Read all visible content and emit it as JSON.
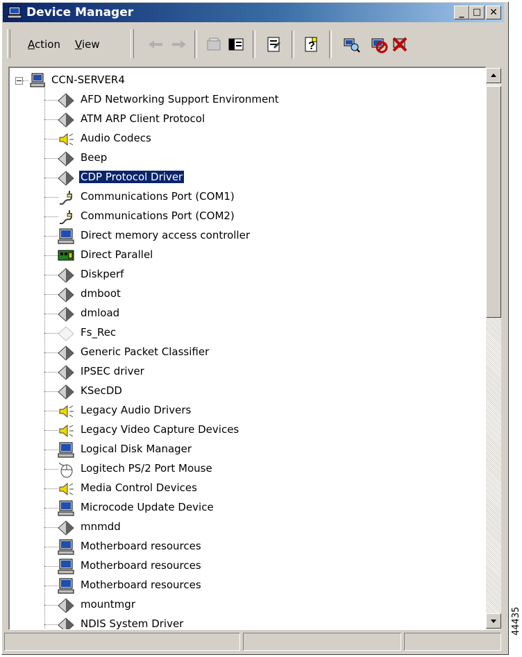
{
  "window": {
    "title": "Device Manager"
  },
  "titlebar": {
    "minimize": "_",
    "maximize": "□",
    "close": "✕"
  },
  "menu": [
    {
      "key": "A",
      "rest": "ction"
    },
    {
      "key": "V",
      "rest": "iew"
    }
  ],
  "tree": {
    "root": "CCN-SERVER4",
    "items": [
      {
        "label": "AFD Networking Support Environment",
        "icon": "diamond-icon"
      },
      {
        "label": "ATM ARP Client Protocol",
        "icon": "diamond-icon"
      },
      {
        "label": "Audio Codecs",
        "icon": "speaker-icon"
      },
      {
        "label": "Beep",
        "icon": "diamond-icon"
      },
      {
        "label": "CDP Protocol Driver",
        "icon": "diamond-icon",
        "selected": true
      },
      {
        "label": "Communications Port (COM1)",
        "icon": "port-icon"
      },
      {
        "label": "Communications Port (COM2)",
        "icon": "port-icon"
      },
      {
        "label": "Direct memory access controller",
        "icon": "computer-icon"
      },
      {
        "label": "Direct Parallel",
        "icon": "network-card-icon"
      },
      {
        "label": "Diskperf",
        "icon": "diamond-icon"
      },
      {
        "label": "dmboot",
        "icon": "diamond-icon"
      },
      {
        "label": "dmload",
        "icon": "diamond-icon"
      },
      {
        "label": "Fs_Rec",
        "icon": "diamond-light-icon"
      },
      {
        "label": "Generic Packet Classifier",
        "icon": "diamond-icon"
      },
      {
        "label": "IPSEC driver",
        "icon": "diamond-icon"
      },
      {
        "label": "KSecDD",
        "icon": "diamond-icon"
      },
      {
        "label": "Legacy Audio Drivers",
        "icon": "speaker-icon"
      },
      {
        "label": "Legacy Video Capture Devices",
        "icon": "speaker-icon"
      },
      {
        "label": "Logical Disk Manager",
        "icon": "computer-icon"
      },
      {
        "label": "Logitech PS/2 Port Mouse",
        "icon": "mouse-icon"
      },
      {
        "label": "Media Control Devices",
        "icon": "speaker-icon"
      },
      {
        "label": "Microcode Update Device",
        "icon": "computer-icon"
      },
      {
        "label": "mnmdd",
        "icon": "diamond-icon"
      },
      {
        "label": "Motherboard resources",
        "icon": "computer-icon"
      },
      {
        "label": "Motherboard resources",
        "icon": "computer-icon"
      },
      {
        "label": "Motherboard resources",
        "icon": "computer-icon"
      },
      {
        "label": "mountmgr",
        "icon": "diamond-icon"
      },
      {
        "label": "NDIS System Driver",
        "icon": "diamond-icon"
      }
    ]
  },
  "figure_number": "44435"
}
